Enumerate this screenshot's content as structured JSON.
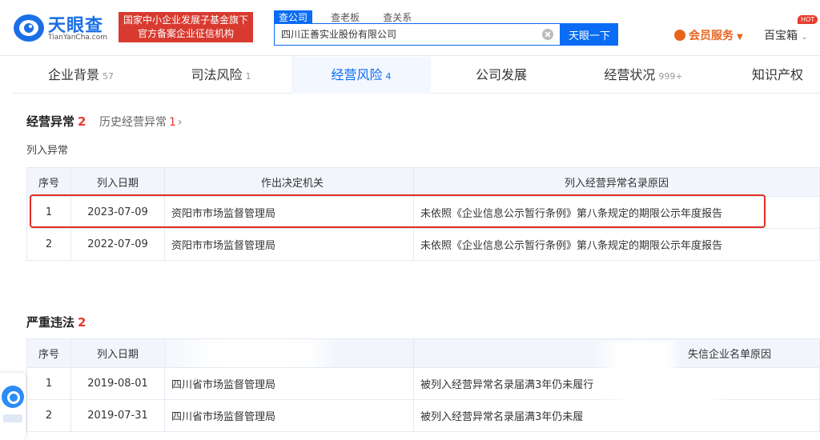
{
  "header": {
    "logo_text": "天眼查",
    "logo_sub": "TianYanCha.com",
    "slogan_line1": "国家中小企业发展子基金旗下",
    "slogan_line2": "官方备案企业征信机构",
    "search_tabs": [
      "查公司",
      "查老板",
      "查关系"
    ],
    "search_value": "四川正善实业股份有限公司",
    "search_button": "天眼一下",
    "vip_label": "会员服务",
    "box_label": "百宝箱",
    "hot_badge": "HOT"
  },
  "nav": {
    "tabs": [
      {
        "label": "企业背景",
        "count": "57"
      },
      {
        "label": "司法风险",
        "count": "1"
      },
      {
        "label": "经营风险",
        "count": "4"
      },
      {
        "label": "公司发展",
        "count": ""
      },
      {
        "label": "经营状况",
        "count": "999+"
      },
      {
        "label": "知识产权",
        "count": ""
      }
    ]
  },
  "abnormal": {
    "title": "经营异常",
    "count": "2",
    "history_label": "历史经营异常",
    "history_count": "1",
    "subtitle": "列入异常",
    "headers": [
      "序号",
      "列入日期",
      "作出决定机关",
      "列入经营异常名录原因"
    ],
    "rows": [
      {
        "idx": "1",
        "date": "2023-07-09",
        "org": "资阳市市场监督管理局",
        "reason": "未依照《企业信息公示暂行条例》第八条规定的期限公示年度报告"
      },
      {
        "idx": "2",
        "date": "2022-07-09",
        "org": "资阳市市场监督管理局",
        "reason": "未依照《企业信息公示暂行条例》第八条规定的期限公示年度报告"
      }
    ]
  },
  "violation": {
    "title": "严重违法",
    "count": "2",
    "headers": [
      "序号",
      "列入日期",
      "",
      "失信企业名单原因"
    ],
    "rows": [
      {
        "idx": "1",
        "date": "2019-08-01",
        "org": "四川省市场监督管理局",
        "reason": "被列入经营异常名录届满3年仍未履行"
      },
      {
        "idx": "2",
        "date": "2019-07-31",
        "org": "四川省市场监督管理局",
        "reason": "被列入经营异常名录届满3年仍未履"
      }
    ]
  }
}
